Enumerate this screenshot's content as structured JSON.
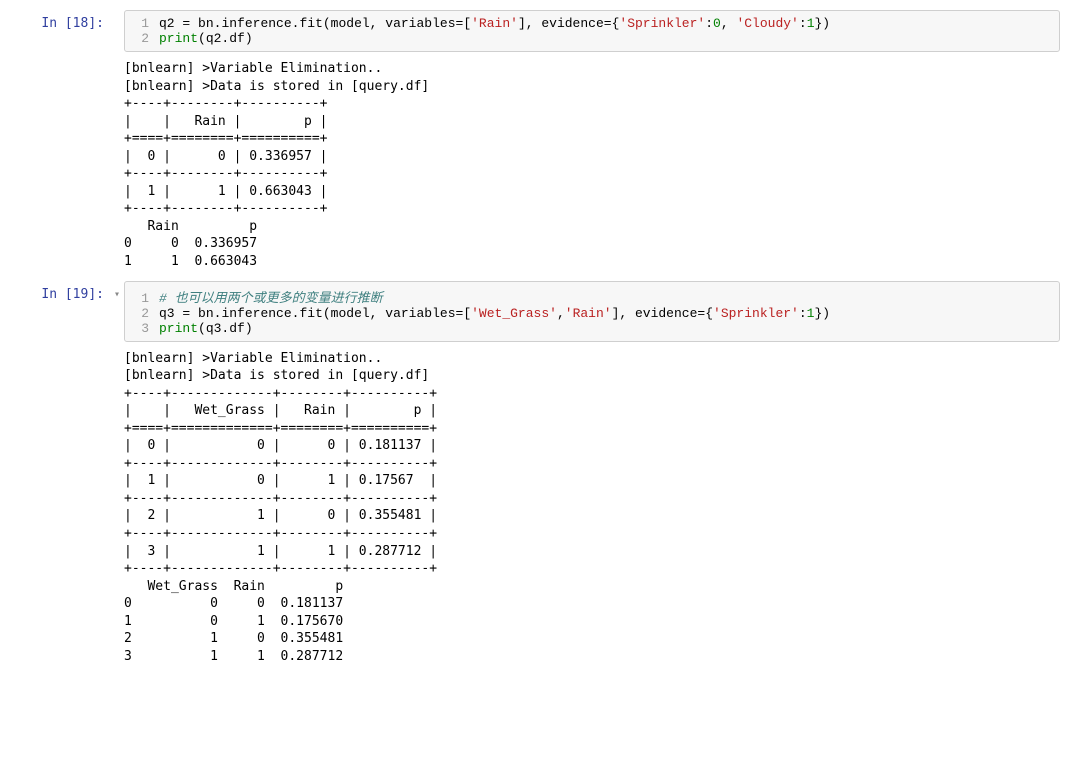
{
  "cells": [
    {
      "prompt": "In [18]:",
      "lines": [
        {
          "n": "1",
          "tokens": [
            {
              "t": "q2 ",
              "c": "nm"
            },
            {
              "t": "=",
              "c": "punct"
            },
            {
              "t": " bn",
              "c": "nm"
            },
            {
              "t": ".",
              "c": "punct"
            },
            {
              "t": "inference",
              "c": "nm"
            },
            {
              "t": ".",
              "c": "punct"
            },
            {
              "t": "fit(model, variables",
              "c": "nm"
            },
            {
              "t": "=",
              "c": "punct"
            },
            {
              "t": "[",
              "c": "punct"
            },
            {
              "t": "'Rain'",
              "c": "str"
            },
            {
              "t": "], evidence",
              "c": "nm"
            },
            {
              "t": "=",
              "c": "punct"
            },
            {
              "t": "{",
              "c": "punct"
            },
            {
              "t": "'Sprinkler'",
              "c": "str"
            },
            {
              "t": ":",
              "c": "punct"
            },
            {
              "t": "0",
              "c": "num"
            },
            {
              "t": ", ",
              "c": "punct"
            },
            {
              "t": "'Cloudy'",
              "c": "str"
            },
            {
              "t": ":",
              "c": "punct"
            },
            {
              "t": "1",
              "c": "num"
            },
            {
              "t": "})",
              "c": "punct"
            }
          ]
        },
        {
          "n": "2",
          "tokens": [
            {
              "t": "print",
              "c": "fn"
            },
            {
              "t": "(q2",
              "c": "nm"
            },
            {
              "t": ".",
              "c": "punct"
            },
            {
              "t": "df)",
              "c": "nm"
            }
          ]
        }
      ],
      "output": "[bnlearn] >Variable Elimination..\n[bnlearn] >Data is stored in [query.df]\n+----+--------+----------+\n|    |   Rain |        p |\n+====+========+==========+\n|  0 |      0 | 0.336957 |\n+----+--------+----------+\n|  1 |      1 | 0.663043 |\n+----+--------+----------+\n   Rain         p\n0     0  0.336957\n1     1  0.663043"
    },
    {
      "prompt": "In [19]:",
      "collapser": "▾",
      "lines": [
        {
          "n": "1",
          "tokens": [
            {
              "t": "# 也可以用两个或更多的变量进行推断",
              "c": "cmt"
            }
          ]
        },
        {
          "n": "2",
          "tokens": [
            {
              "t": "q3 ",
              "c": "nm"
            },
            {
              "t": "=",
              "c": "punct"
            },
            {
              "t": " bn",
              "c": "nm"
            },
            {
              "t": ".",
              "c": "punct"
            },
            {
              "t": "inference",
              "c": "nm"
            },
            {
              "t": ".",
              "c": "punct"
            },
            {
              "t": "fit(model, variables",
              "c": "nm"
            },
            {
              "t": "=",
              "c": "punct"
            },
            {
              "t": "[",
              "c": "punct"
            },
            {
              "t": "'Wet_Grass'",
              "c": "str"
            },
            {
              "t": ",",
              "c": "punct"
            },
            {
              "t": "'Rain'",
              "c": "str"
            },
            {
              "t": "], evidence",
              "c": "nm"
            },
            {
              "t": "=",
              "c": "punct"
            },
            {
              "t": "{",
              "c": "punct"
            },
            {
              "t": "'Sprinkler'",
              "c": "str"
            },
            {
              "t": ":",
              "c": "punct"
            },
            {
              "t": "1",
              "c": "num"
            },
            {
              "t": "})",
              "c": "punct"
            }
          ]
        },
        {
          "n": "3",
          "tokens": [
            {
              "t": "print",
              "c": "fn"
            },
            {
              "t": "(q3",
              "c": "nm"
            },
            {
              "t": ".",
              "c": "punct"
            },
            {
              "t": "df)",
              "c": "nm"
            }
          ]
        }
      ],
      "output": "[bnlearn] >Variable Elimination..\n[bnlearn] >Data is stored in [query.df]\n+----+-------------+--------+----------+\n|    |   Wet_Grass |   Rain |        p |\n+====+=============+========+==========+\n|  0 |           0 |      0 | 0.181137 |\n+----+-------------+--------+----------+\n|  1 |           0 |      1 | 0.17567  |\n+----+-------------+--------+----------+\n|  2 |           1 |      0 | 0.355481 |\n+----+-------------+--------+----------+\n|  3 |           1 |      1 | 0.287712 |\n+----+-------------+--------+----------+\n   Wet_Grass  Rain         p\n0          0     0  0.181137\n1          0     1  0.175670\n2          1     0  0.355481\n3          1     1  0.287712"
    }
  ]
}
